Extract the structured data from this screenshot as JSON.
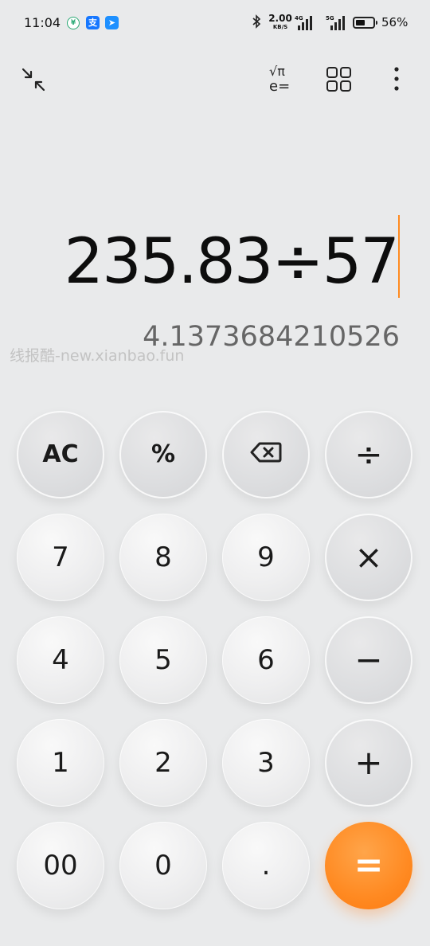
{
  "status_bar": {
    "time": "11:04",
    "speed_value": "2.00",
    "speed_unit": "KB/S",
    "signal1_tag": "4G",
    "signal2_tag": "5G",
    "battery_percent": "56%",
    "battery_level": 0.56,
    "app_icons": [
      "wechat-pay-icon",
      "alipay-icon",
      "message-app-icon"
    ]
  },
  "toolbar": {
    "shrink_icon": "shrink-arrows-icon",
    "scientific_icon": "scientific-mode-icon",
    "scientific_top": "√π",
    "scientific_bottom": "e=",
    "apps_icon": "grid-icon",
    "more_icon": "more-vertical-icon"
  },
  "display": {
    "expression": "235.83÷57",
    "result": "4.1373684210526",
    "watermark": "线报酷-new.xianbao.fun",
    "accent_color": "#ff8a1f"
  },
  "keypad": {
    "rows": [
      [
        {
          "label": "AC",
          "type": "op"
        },
        {
          "label": "%",
          "type": "op"
        },
        {
          "label": "⌫",
          "type": "op"
        },
        {
          "label": "÷",
          "type": "op"
        }
      ],
      [
        {
          "label": "7",
          "type": "num"
        },
        {
          "label": "8",
          "type": "num"
        },
        {
          "label": "9",
          "type": "num"
        },
        {
          "label": "×",
          "type": "op"
        }
      ],
      [
        {
          "label": "4",
          "type": "num"
        },
        {
          "label": "5",
          "type": "num"
        },
        {
          "label": "6",
          "type": "num"
        },
        {
          "label": "−",
          "type": "op"
        }
      ],
      [
        {
          "label": "1",
          "type": "num"
        },
        {
          "label": "2",
          "type": "num"
        },
        {
          "label": "3",
          "type": "num"
        },
        {
          "label": "+",
          "type": "op"
        }
      ],
      [
        {
          "label": "00",
          "type": "num"
        },
        {
          "label": "0",
          "type": "num"
        },
        {
          "label": ".",
          "type": "num"
        },
        {
          "label": "=",
          "type": "eq"
        }
      ]
    ]
  }
}
